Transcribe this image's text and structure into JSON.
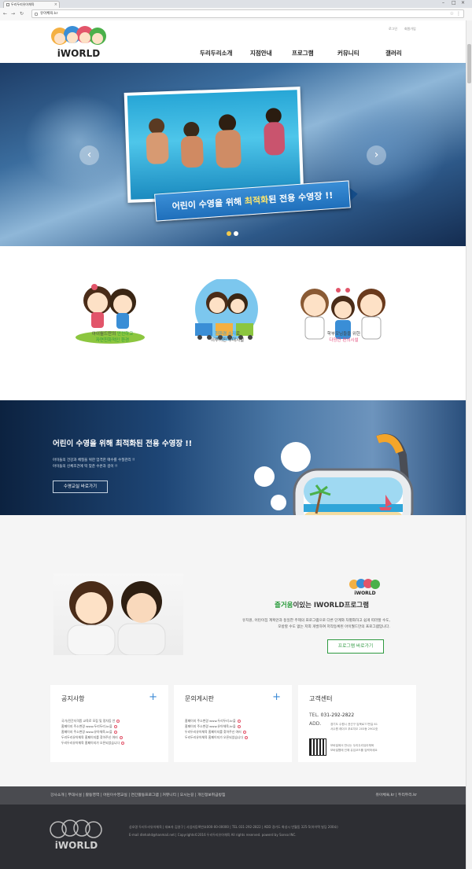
{
  "browser": {
    "tab_title": "두리두리유아체육",
    "url": "유아체육.kr"
  },
  "header": {
    "top_links": [
      "로그인",
      "회원가입"
    ],
    "logo_text": "iWORLD",
    "nav": [
      "두리두리소개",
      "지점안내",
      "프로그램",
      "커뮤니티",
      "갤러리"
    ]
  },
  "hero": {
    "banner_prefix": "어린이 수영을 위해 ",
    "banner_highlight": "최적화",
    "banner_suffix": "된 전용 수영장 !!",
    "prev_icon": "chevron-left-icon",
    "next_icon": "chevron-right-icon",
    "slides": 2,
    "active_slide": 1
  },
  "features": [
    {
      "line1_prefix": "아이월드만의 ",
      "line1_highlight": "안전하고",
      "line2": "자연친화적인 환경"
    },
    {
      "line1_highlight": "친환경 소재",
      "line1_suffix": "로",
      "line2": "이루어진 부대시설"
    },
    {
      "line1": "학부모님들을 위한",
      "line2": "다양한 편의시설"
    }
  ],
  "promo": {
    "title": "어린이 수영을 위해 최적화된 전용 수영장 !!",
    "desc1": "아이들의 건강과 체질을 위한 엄격한 매수를 수질관리 !!",
    "desc2": "아이들의 신체조건에 딱 맞춘 수온과 깊이 !!",
    "button": "수영교실 바로가기"
  },
  "program": {
    "heading_highlight": "즐거움",
    "heading_suffix": "이있는 IWORLD프로그램",
    "desc1": "유치원, 어린이집 계획안과 동일한 주제의 프로그램으로 다른 단계와 차별화하고 쉽게 따라할 수도,",
    "desc2": "모방할 수도 없는 저희 개발하여 저작등록된 아이월드만의 프로그램입니다.",
    "button": "프로그램 바로가기"
  },
  "boards": {
    "notice": {
      "title": "공지사항",
      "items": [
        "국가/민간자격증 교육로 모집 및 정차등 안",
        "홈페이지 주소변경 www.두리두리.kr을",
        "홈페이지 주소변경 www.유아체육.kr을",
        "두리두리유아체육 홈페이지를 찾아주신 여러",
        "두리두리유아체육 홈페이지가 오픈되었습니다"
      ]
    },
    "qna": {
      "title": "문의게시판",
      "items": [
        "홈페이지 주소변경 www.두리두리.kr을",
        "홈페이지 주소변경 www.유아체육.kr을",
        "두리두리유아체육 홈페이지를 찾아주신 여러",
        "두리두리유아체육 홈페이지가 오픈되었습니다"
      ]
    },
    "cs": {
      "title": "고객센터",
      "tel_label": "TEL.",
      "tel": "031-292-2822",
      "addr_label": "ADD.",
      "addr1": "경기도 수원시 권선구 입북로77번길 61",
      "addr2": "서수원 레이크 푸르지오 203동 2902호",
      "qr1": "모바일에서 만나는 두리두리유아체육",
      "qr2": "모바일웹에 인해 유입코드를 입력하세요"
    }
  },
  "footer": {
    "links": "강사소개 | 부대시설 | 활동영역 | 어린이수영교실 | 연간활동프로그램 | 커뮤니티 | 오시는길 | 개인정보취급방침",
    "right_links": "유아체육.kr  |  두리두리.kr",
    "info1": "상호명 두리두리유아체육 | 대표자 김영구 | 사업자등록번호000-00-00000 | TEL 031-292-2822 | ADD 경기도 화성시 반월동 325-5(하이텍 빌딩 200호)",
    "info2": "E-mail dlehahd@hanmail.net | Copyrights©2016 두리두리유아체육 All rights reserved. powerd by Sonso INC.",
    "logo_text": "iWORLD"
  },
  "colors": {
    "nav_text": "#222222",
    "accent_green": "#2a9c3c",
    "accent_blue": "#3b8ad6",
    "footer_dark": "#2d2e33"
  }
}
